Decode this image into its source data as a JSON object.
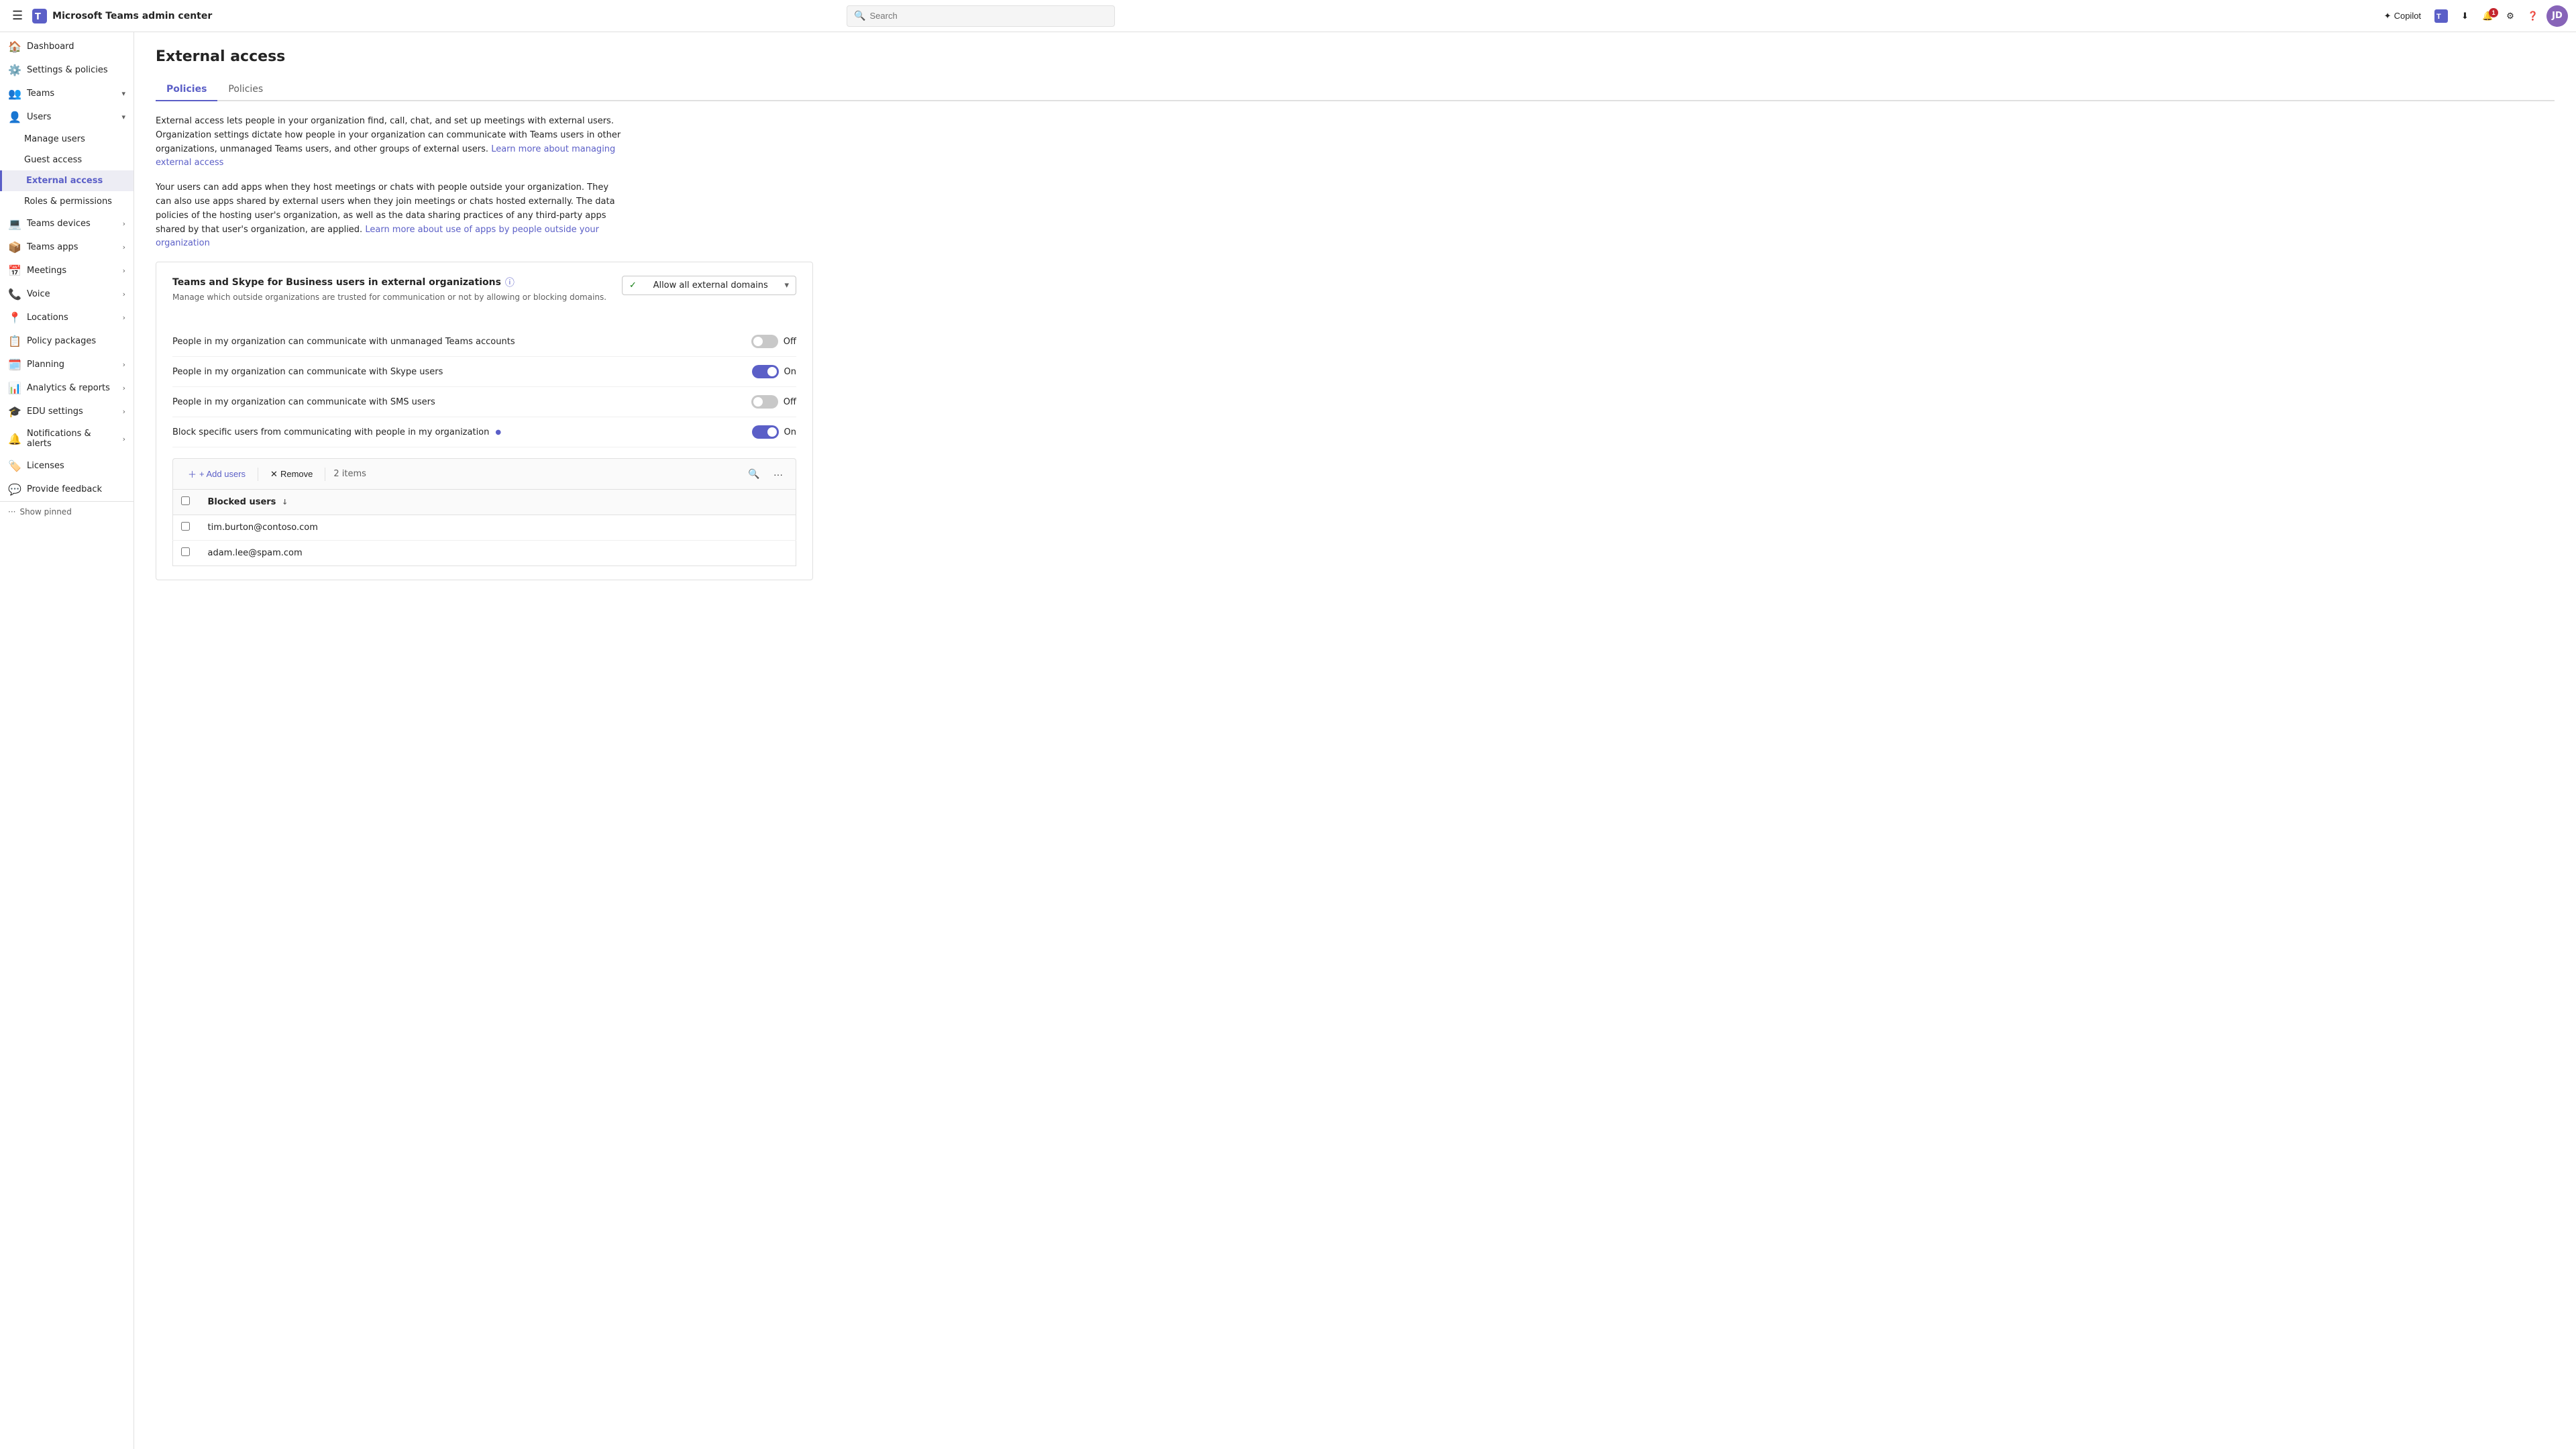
{
  "app": {
    "title": "Microsoft Teams admin center",
    "search_placeholder": "Search"
  },
  "topnav": {
    "copilot_label": "Copilot",
    "notification_count": "1",
    "avatar_initials": "JD"
  },
  "sidebar": {
    "collapse_label": "",
    "items": [
      {
        "id": "dashboard",
        "label": "Dashboard",
        "icon": "🏠",
        "indent": false,
        "active": false,
        "has_children": false
      },
      {
        "id": "settings-policies",
        "label": "Settings & policies",
        "icon": "⚙️",
        "indent": false,
        "active": false,
        "has_children": false
      },
      {
        "id": "teams",
        "label": "Teams",
        "icon": "👥",
        "indent": false,
        "active": false,
        "has_children": true,
        "expanded": true
      },
      {
        "id": "users",
        "label": "Users",
        "icon": "👤",
        "indent": false,
        "active": false,
        "has_children": true,
        "expanded": true
      },
      {
        "id": "manage-users",
        "label": "Manage users",
        "icon": "",
        "indent": true,
        "active": false,
        "has_children": false
      },
      {
        "id": "guest-access",
        "label": "Guest access",
        "icon": "",
        "indent": true,
        "active": false,
        "has_children": false
      },
      {
        "id": "external-access",
        "label": "External access",
        "icon": "",
        "indent": true,
        "active": true,
        "has_children": false
      },
      {
        "id": "roles-permissions",
        "label": "Roles & permissions",
        "icon": "",
        "indent": true,
        "active": false,
        "has_children": false
      },
      {
        "id": "teams-devices",
        "label": "Teams devices",
        "icon": "💻",
        "indent": false,
        "active": false,
        "has_children": true
      },
      {
        "id": "teams-apps",
        "label": "Teams apps",
        "icon": "📦",
        "indent": false,
        "active": false,
        "has_children": true
      },
      {
        "id": "meetings",
        "label": "Meetings",
        "icon": "📅",
        "indent": false,
        "active": false,
        "has_children": true
      },
      {
        "id": "voice",
        "label": "Voice",
        "icon": "📞",
        "indent": false,
        "active": false,
        "has_children": true
      },
      {
        "id": "locations",
        "label": "Locations",
        "icon": "📍",
        "indent": false,
        "active": false,
        "has_children": true
      },
      {
        "id": "policy-packages",
        "label": "Policy packages",
        "icon": "📋",
        "indent": false,
        "active": false,
        "has_children": false
      },
      {
        "id": "planning",
        "label": "Planning",
        "icon": "🗓️",
        "indent": false,
        "active": false,
        "has_children": true
      },
      {
        "id": "analytics-reports",
        "label": "Analytics & reports",
        "icon": "📊",
        "indent": false,
        "active": false,
        "has_children": true
      },
      {
        "id": "edu-settings",
        "label": "EDU settings",
        "icon": "🎓",
        "indent": false,
        "active": false,
        "has_children": true
      },
      {
        "id": "notifications-alerts",
        "label": "Notifications & alerts",
        "icon": "🔔",
        "indent": false,
        "active": false,
        "has_children": true
      },
      {
        "id": "licenses",
        "label": "Licenses",
        "icon": "🏷️",
        "indent": false,
        "active": false,
        "has_children": false
      },
      {
        "id": "provide-feedback",
        "label": "Provide feedback",
        "icon": "💬",
        "indent": false,
        "active": false,
        "has_children": false
      }
    ],
    "show_pinned_label": "Show pinned",
    "more_label": "..."
  },
  "page": {
    "title": "External access",
    "tabs": [
      {
        "id": "policies",
        "label": "Policies",
        "active": true
      },
      {
        "id": "policies2",
        "label": "Policies",
        "active": false
      }
    ],
    "description1": "External access lets people in your organization find, call, chat, and set up meetings with external users. Organization settings dictate how people in your organization can communicate with Teams users in other organizations, unmanaged Teams users, and other groups of external users.",
    "description1_link": "Learn more about managing external access",
    "description2": "Your users can add apps when they host meetings or chats with people outside your organization. They can also use apps shared by external users when they join meetings or chats hosted externally. The data policies of the hosting user's organization, as well as the data sharing practices of any third-party apps shared by that user's organization, are applied.",
    "description2_link": "Learn more about use of apps by people outside your organization"
  },
  "external_orgs_section": {
    "title": "Teams and Skype for Business users in external organizations",
    "description": "Manage which outside organizations are trusted for communication or not by allowing or blocking domains.",
    "dropdown_value": "Allow all external domains",
    "dropdown_icon": "✅"
  },
  "toggles": [
    {
      "id": "unmanaged-teams",
      "label": "People in my organization can communicate with unmanaged Teams accounts",
      "state": false,
      "status_label_on": "On",
      "status_label_off": "Off"
    },
    {
      "id": "skype",
      "label": "People in my organization can communicate with Skype users",
      "state": true,
      "status_label_on": "On",
      "status_label_off": "Off"
    },
    {
      "id": "sms",
      "label": "People in my organization can communicate with SMS users",
      "state": false,
      "status_label_on": "On",
      "status_label_off": "Off"
    },
    {
      "id": "block-specific",
      "label": "Block specific users from communicating with people in my organization",
      "state": true,
      "has_dot": true,
      "status_label_on": "On",
      "status_label_off": "Off"
    }
  ],
  "blocked_users": {
    "add_label": "+ Add users",
    "remove_label": "Remove",
    "items_count": "2 items",
    "column_label": "Blocked users",
    "users": [
      {
        "email": "tim.burton@contoso.com"
      },
      {
        "email": "adam.lee@spam.com"
      }
    ]
  }
}
